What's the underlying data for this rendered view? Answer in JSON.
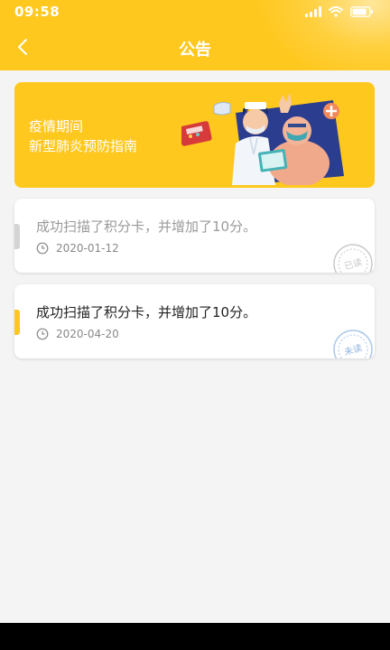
{
  "status_bar": {
    "time": "09:58"
  },
  "header": {
    "title": "公告",
    "color": "#ffc81e"
  },
  "banner": {
    "line1": "疫情期间",
    "line2": "新型肺炎预防指南"
  },
  "notices": [
    {
      "title": "成功扫描了积分卡，并增加了10分。",
      "date": "2020-01-12",
      "read": true,
      "stamp": "已读"
    },
    {
      "title": "成功扫描了积分卡，并增加了10分。",
      "date": "2020-04-20",
      "read": false,
      "stamp": "未读"
    }
  ]
}
